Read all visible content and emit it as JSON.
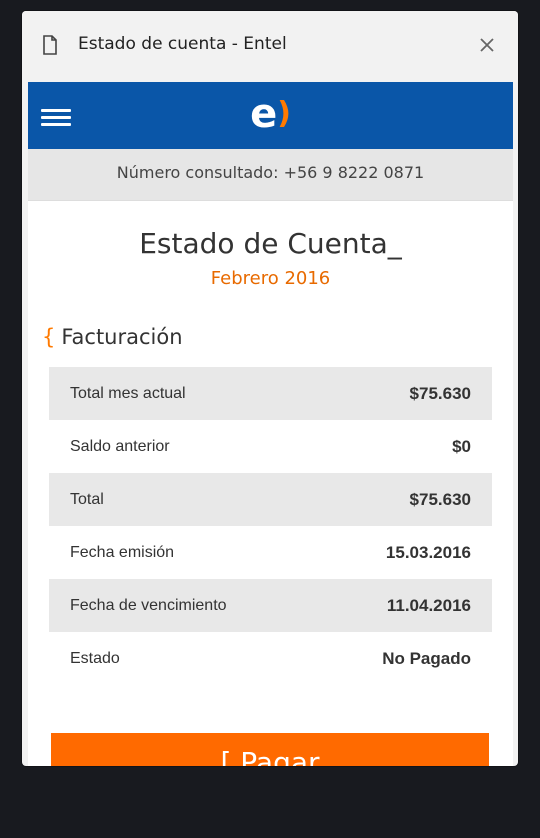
{
  "window": {
    "title": "Estado de cuenta - Entel"
  },
  "header": {
    "logo_letter": "e",
    "logo_paren": ")"
  },
  "number_bar": {
    "text": "Número consultado: +56 9 8222 0871"
  },
  "statement": {
    "title": "Estado de Cuenta_",
    "period": "Febrero 2016"
  },
  "section": {
    "brace": "{",
    "title": "Facturación"
  },
  "billing": {
    "rows": [
      {
        "label": "Total mes actual",
        "value": "$75.630"
      },
      {
        "label": "Saldo anterior",
        "value": "$0"
      },
      {
        "label": "Total",
        "value": "$75.630"
      },
      {
        "label": "Fecha emisión",
        "value": "15.03.2016"
      },
      {
        "label": "Fecha de vencimiento",
        "value": "11.04.2016"
      },
      {
        "label": "Estado",
        "value": "No Pagado"
      }
    ]
  },
  "pay_button": {
    "label": "[ Pagar"
  },
  "colors": {
    "brand_blue": "#0a56a8",
    "brand_orange": "#ff6a00"
  },
  "icons": {
    "window": "document-icon",
    "close": "close-icon",
    "menu": "hamburger-menu-icon"
  }
}
